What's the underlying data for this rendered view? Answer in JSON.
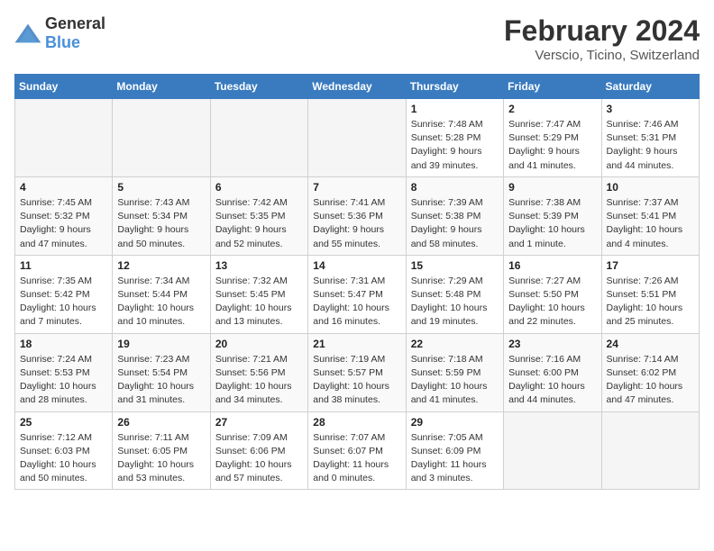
{
  "header": {
    "logo_general": "General",
    "logo_blue": "Blue",
    "month_year": "February 2024",
    "location": "Verscio, Ticino, Switzerland"
  },
  "weekdays": [
    "Sunday",
    "Monday",
    "Tuesday",
    "Wednesday",
    "Thursday",
    "Friday",
    "Saturday"
  ],
  "weeks": [
    [
      {
        "day": "",
        "info": ""
      },
      {
        "day": "",
        "info": ""
      },
      {
        "day": "",
        "info": ""
      },
      {
        "day": "",
        "info": ""
      },
      {
        "day": "1",
        "info": "Sunrise: 7:48 AM\nSunset: 5:28 PM\nDaylight: 9 hours\nand 39 minutes."
      },
      {
        "day": "2",
        "info": "Sunrise: 7:47 AM\nSunset: 5:29 PM\nDaylight: 9 hours\nand 41 minutes."
      },
      {
        "day": "3",
        "info": "Sunrise: 7:46 AM\nSunset: 5:31 PM\nDaylight: 9 hours\nand 44 minutes."
      }
    ],
    [
      {
        "day": "4",
        "info": "Sunrise: 7:45 AM\nSunset: 5:32 PM\nDaylight: 9 hours\nand 47 minutes."
      },
      {
        "day": "5",
        "info": "Sunrise: 7:43 AM\nSunset: 5:34 PM\nDaylight: 9 hours\nand 50 minutes."
      },
      {
        "day": "6",
        "info": "Sunrise: 7:42 AM\nSunset: 5:35 PM\nDaylight: 9 hours\nand 52 minutes."
      },
      {
        "day": "7",
        "info": "Sunrise: 7:41 AM\nSunset: 5:36 PM\nDaylight: 9 hours\nand 55 minutes."
      },
      {
        "day": "8",
        "info": "Sunrise: 7:39 AM\nSunset: 5:38 PM\nDaylight: 9 hours\nand 58 minutes."
      },
      {
        "day": "9",
        "info": "Sunrise: 7:38 AM\nSunset: 5:39 PM\nDaylight: 10 hours\nand 1 minute."
      },
      {
        "day": "10",
        "info": "Sunrise: 7:37 AM\nSunset: 5:41 PM\nDaylight: 10 hours\nand 4 minutes."
      }
    ],
    [
      {
        "day": "11",
        "info": "Sunrise: 7:35 AM\nSunset: 5:42 PM\nDaylight: 10 hours\nand 7 minutes."
      },
      {
        "day": "12",
        "info": "Sunrise: 7:34 AM\nSunset: 5:44 PM\nDaylight: 10 hours\nand 10 minutes."
      },
      {
        "day": "13",
        "info": "Sunrise: 7:32 AM\nSunset: 5:45 PM\nDaylight: 10 hours\nand 13 minutes."
      },
      {
        "day": "14",
        "info": "Sunrise: 7:31 AM\nSunset: 5:47 PM\nDaylight: 10 hours\nand 16 minutes."
      },
      {
        "day": "15",
        "info": "Sunrise: 7:29 AM\nSunset: 5:48 PM\nDaylight: 10 hours\nand 19 minutes."
      },
      {
        "day": "16",
        "info": "Sunrise: 7:27 AM\nSunset: 5:50 PM\nDaylight: 10 hours\nand 22 minutes."
      },
      {
        "day": "17",
        "info": "Sunrise: 7:26 AM\nSunset: 5:51 PM\nDaylight: 10 hours\nand 25 minutes."
      }
    ],
    [
      {
        "day": "18",
        "info": "Sunrise: 7:24 AM\nSunset: 5:53 PM\nDaylight: 10 hours\nand 28 minutes."
      },
      {
        "day": "19",
        "info": "Sunrise: 7:23 AM\nSunset: 5:54 PM\nDaylight: 10 hours\nand 31 minutes."
      },
      {
        "day": "20",
        "info": "Sunrise: 7:21 AM\nSunset: 5:56 PM\nDaylight: 10 hours\nand 34 minutes."
      },
      {
        "day": "21",
        "info": "Sunrise: 7:19 AM\nSunset: 5:57 PM\nDaylight: 10 hours\nand 38 minutes."
      },
      {
        "day": "22",
        "info": "Sunrise: 7:18 AM\nSunset: 5:59 PM\nDaylight: 10 hours\nand 41 minutes."
      },
      {
        "day": "23",
        "info": "Sunrise: 7:16 AM\nSunset: 6:00 PM\nDaylight: 10 hours\nand 44 minutes."
      },
      {
        "day": "24",
        "info": "Sunrise: 7:14 AM\nSunset: 6:02 PM\nDaylight: 10 hours\nand 47 minutes."
      }
    ],
    [
      {
        "day": "25",
        "info": "Sunrise: 7:12 AM\nSunset: 6:03 PM\nDaylight: 10 hours\nand 50 minutes."
      },
      {
        "day": "26",
        "info": "Sunrise: 7:11 AM\nSunset: 6:05 PM\nDaylight: 10 hours\nand 53 minutes."
      },
      {
        "day": "27",
        "info": "Sunrise: 7:09 AM\nSunset: 6:06 PM\nDaylight: 10 hours\nand 57 minutes."
      },
      {
        "day": "28",
        "info": "Sunrise: 7:07 AM\nSunset: 6:07 PM\nDaylight: 11 hours\nand 0 minutes."
      },
      {
        "day": "29",
        "info": "Sunrise: 7:05 AM\nSunset: 6:09 PM\nDaylight: 11 hours\nand 3 minutes."
      },
      {
        "day": "",
        "info": ""
      },
      {
        "day": "",
        "info": ""
      }
    ]
  ]
}
